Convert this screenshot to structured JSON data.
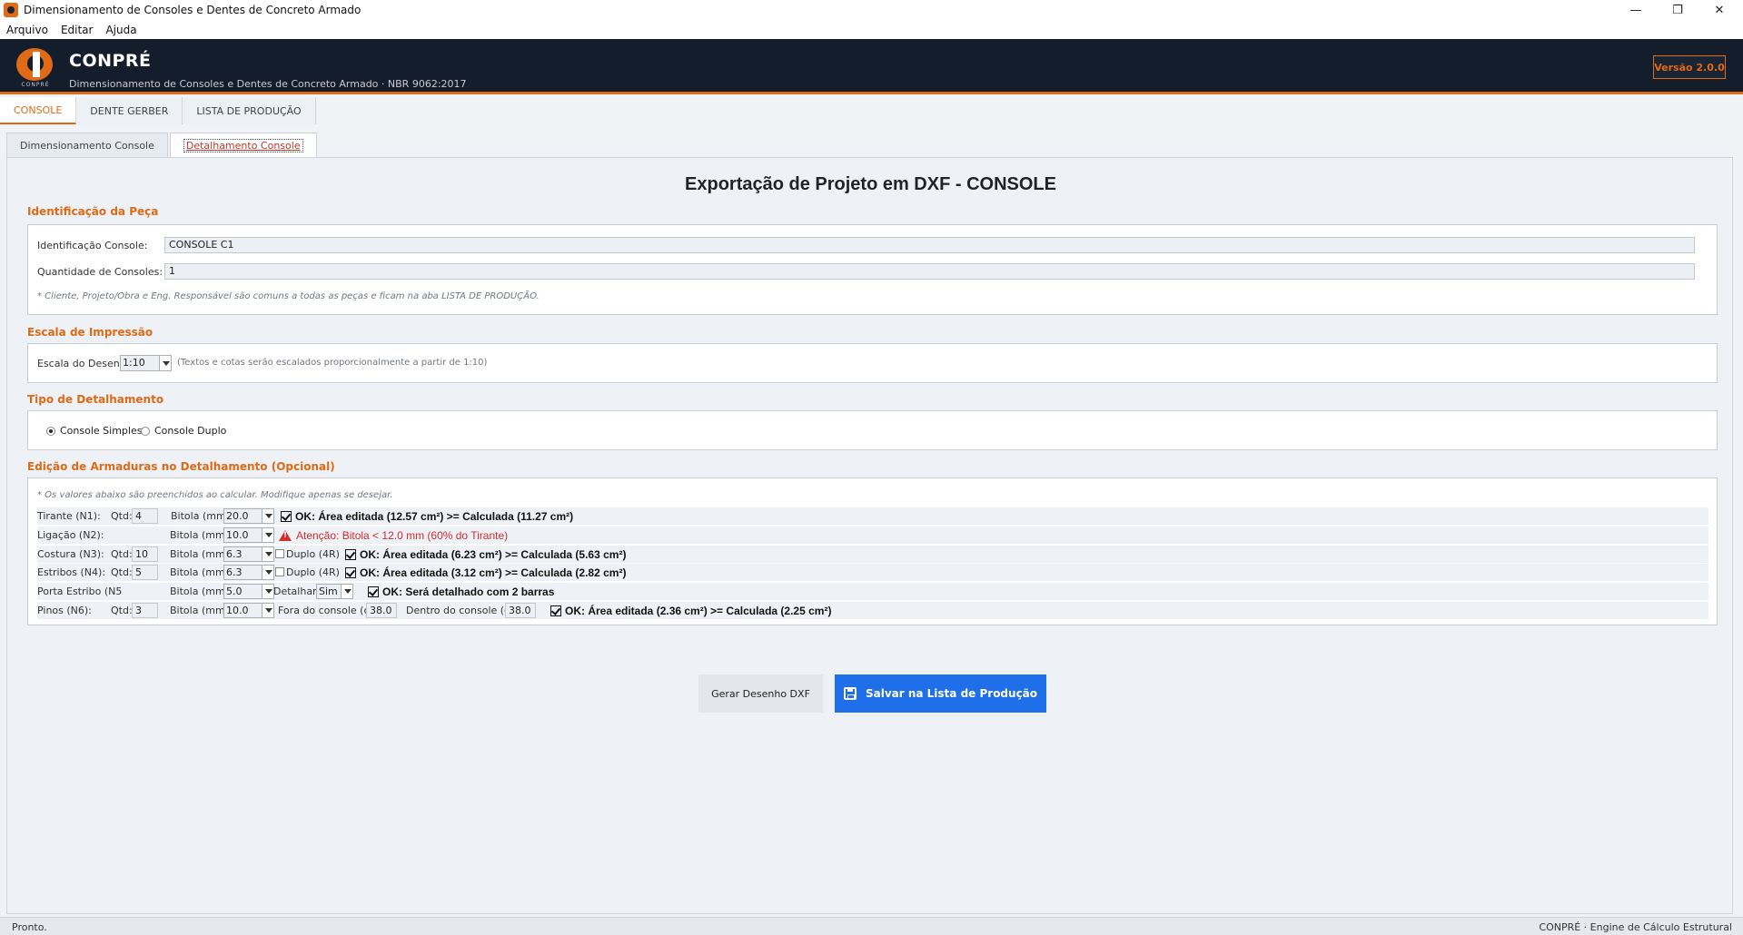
{
  "window": {
    "title": "Dimensionamento de Consoles e Dentes de Concreto Armado",
    "controls": {
      "minimize": "—",
      "maximize": "❐",
      "close": "✕"
    }
  },
  "menu": [
    "Arquivo",
    "Editar",
    "Ajuda"
  ],
  "header": {
    "logo_caption": "CONPRÉ",
    "brand": "CONPRÉ",
    "subtitle": "Dimensionamento de Consoles e Dentes de Concreto Armado  ·  NBR 9062:2017",
    "version": "Versão 2.0.0",
    "accent_color": "#e06a16",
    "background_color": "#141d2b"
  },
  "main_tabs": [
    {
      "label": "CONSOLE",
      "active": true
    },
    {
      "label": "DENTE GERBER",
      "active": false
    },
    {
      "label": "LISTA DE PRODUÇÃO",
      "active": false
    }
  ],
  "sub_tabs": [
    {
      "label": "Dimensionamento Console",
      "active": false
    },
    {
      "label": "Detalhamento Console",
      "active": true
    }
  ],
  "page_title": "Exportação de Projeto em DXF - CONSOLE",
  "identificacao": {
    "section_title": "Identificação da Peça",
    "id_label": "Identificação Console:",
    "id_value": "CONSOLE C1",
    "qty_label": "Quantidade de Consoles:",
    "qty_value": "1",
    "note": "* Cliente, Projeto/Obra e Eng. Responsável são comuns a todas as peças e ficam na aba LISTA DE PRODUÇÃO."
  },
  "escala": {
    "section_title": "Escala de Impressão",
    "label": "Escala do Desenho:",
    "value": "1:10",
    "note": "(Textos e cotas serão escalados proporcionalmente a partir de 1:10)"
  },
  "tipo": {
    "section_title": "Tipo de Detalhamento",
    "options": [
      {
        "label": "Console Simples",
        "selected": true
      },
      {
        "label": "Console Duplo",
        "selected": false
      }
    ]
  },
  "armaduras": {
    "section_title": "Edição de Armaduras no Detalhamento (Opcional)",
    "note": "* Os valores abaixo são preenchidos ao calcular. Modifique apenas se desejar.",
    "qtd_label": "Qtd:",
    "bitola_label": "Bitola (mm):",
    "duplo_label": "Duplo (4R)",
    "detalhar_label": "Detalhar?",
    "fora_label": "Fora do console (cm):",
    "dentro_label": "Dentro do console (cm):",
    "rows": {
      "tirante": {
        "label": "Tirante (N1):",
        "qtd": "4",
        "bitola": "20.0",
        "status": "OK: Área editada (12.57 cm²) >= Calculada (11.27 cm²)"
      },
      "ligacao": {
        "label": "Ligação (N2):",
        "bitola": "10.0",
        "status": "Atenção: Bitola < 12.0 mm (60% do Tirante)"
      },
      "costura": {
        "label": "Costura (N3):",
        "qtd": "10",
        "bitola": "6.3",
        "duplo": false,
        "status": "OK: Área editada (6.23 cm²) >= Calculada (5.63 cm²)"
      },
      "estribos": {
        "label": "Estribos (N4):",
        "qtd": "5",
        "bitola": "6.3",
        "duplo": false,
        "status": "OK: Área editada (3.12 cm²) >= Calculada (2.82 cm²)"
      },
      "porta": {
        "label": "Porta Estribo (N5",
        "bitola": "5.0",
        "detalhar": "Sim",
        "status": "OK: Será detalhado com 2 barras"
      },
      "pinos": {
        "label": "Pinos (N6):",
        "qtd": "3",
        "bitola": "10.0",
        "fora": "38.0",
        "dentro": "38.0",
        "status": "OK: Área editada (2.36 cm²) >= Calculada (2.25 cm²)"
      }
    }
  },
  "buttons": {
    "dxf": "Gerar Desenho DXF",
    "save": "Salvar na Lista de Produção"
  },
  "statusbar": {
    "left": "Pronto.",
    "right": "CONPRÉ  ·  Engine de Cálculo Estrutural"
  }
}
